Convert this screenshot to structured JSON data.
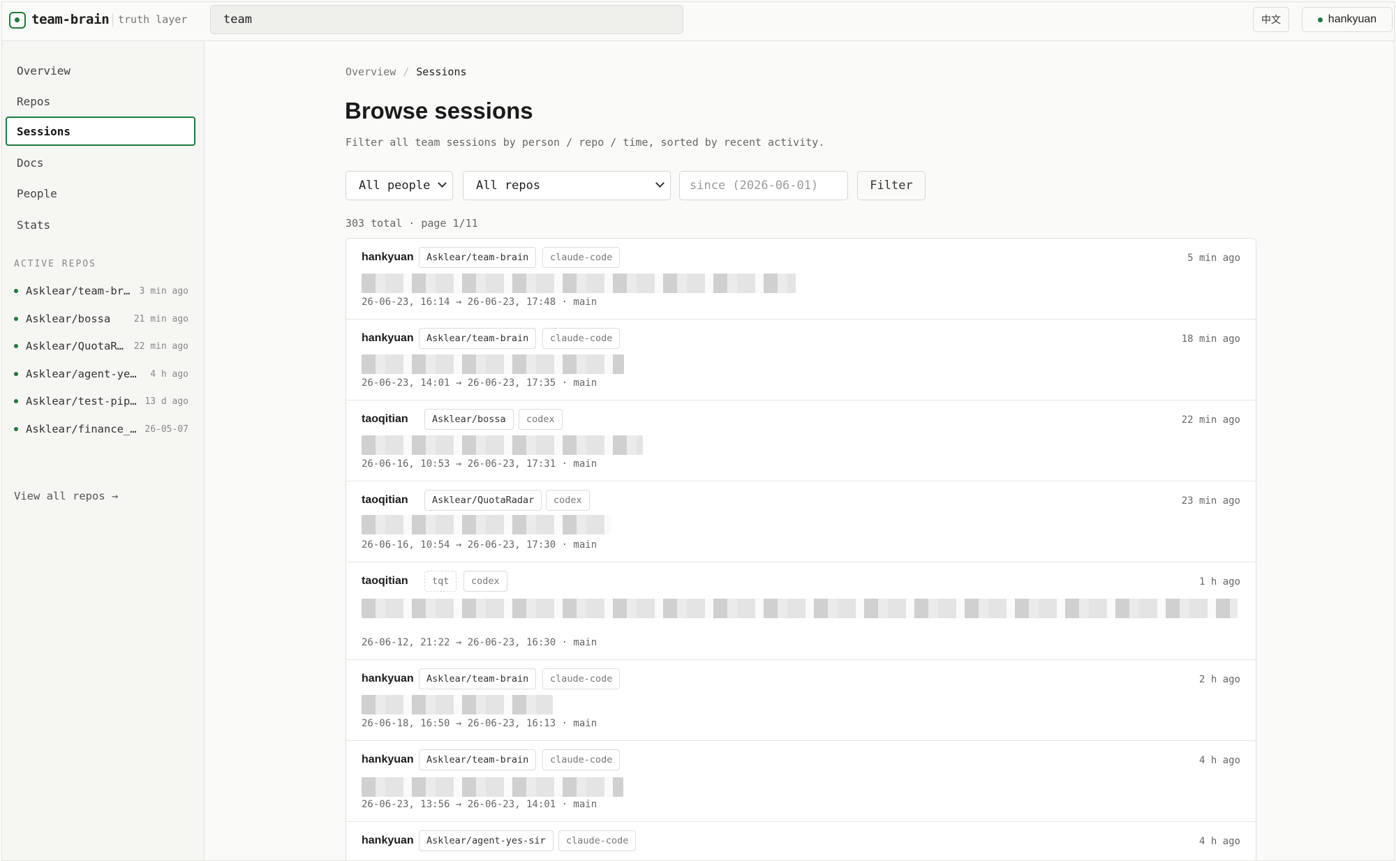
{
  "header": {
    "brand_name": "team-brain",
    "brand_tag": "truth layer",
    "search_value": "team",
    "lang_label": "中文",
    "user_label": "hankyuan"
  },
  "sidebar": {
    "items": [
      {
        "label": "Overview"
      },
      {
        "label": "Repos"
      },
      {
        "label": "Sessions",
        "active": true
      },
      {
        "label": "Docs"
      },
      {
        "label": "People"
      },
      {
        "label": "Stats"
      }
    ],
    "section_label": "ACTIVE REPOS",
    "repos": [
      {
        "name": "Asklear/team-br…",
        "time": "3 min ago"
      },
      {
        "name": "Asklear/bossa",
        "time": "21 min ago"
      },
      {
        "name": "Asklear/QuotaR…",
        "time": "22 min ago"
      },
      {
        "name": "Asklear/agent-ye…",
        "time": "4 h ago"
      },
      {
        "name": "Asklear/test-pip…",
        "time": "13 d ago"
      },
      {
        "name": "Asklear/finance_…",
        "time": "26-05-07"
      }
    ],
    "view_all": "View all repos →"
  },
  "main": {
    "breadcrumb": {
      "root": "Overview",
      "sep": "/",
      "current": "Sessions"
    },
    "title": "Browse sessions",
    "subtitle": "Filter all team sessions by person / repo / time, sorted by recent activity.",
    "filters": {
      "people": "All people",
      "repos": "All repos",
      "since_placeholder": "since (2026-06-01)",
      "filter_label": "Filter"
    },
    "total": "303 total · page 1/11",
    "sessions": [
      {
        "who": "hankyuan",
        "repo": "Asklear/team-brain",
        "agent": "claude-code",
        "ago": "5 min ago",
        "range": "26-06-23, 16:14 → 26-06-23, 17:48 · main"
      },
      {
        "who": "hankyuan",
        "repo": "Asklear/team-brain",
        "agent": "claude-code",
        "ago": "18 min ago",
        "range": "26-06-23, 14:01 → 26-06-23, 17:35 · main"
      },
      {
        "who": "taoqitian",
        "repo": "Asklear/bossa",
        "agent": "codex",
        "ago": "22 min ago",
        "range": "26-06-16, 10:53 → 26-06-23, 17:31 · main"
      },
      {
        "who": "taoqitian",
        "repo": "Asklear/QuotaRadar",
        "agent": "codex",
        "ago": "23 min ago",
        "range": "26-06-16, 10:54 → 26-06-23, 17:30 · main"
      },
      {
        "who": "taoqitian",
        "repo": "tqt",
        "agent": "codex",
        "ago": "1 h ago",
        "range": "26-06-12, 21:22 → 26-06-23, 16:30 · main"
      },
      {
        "who": "hankyuan",
        "repo": "Asklear/team-brain",
        "agent": "claude-code",
        "ago": "2 h ago",
        "range": "26-06-18, 16:50 → 26-06-23, 16:13 · main"
      },
      {
        "who": "hankyuan",
        "repo": "Asklear/team-brain",
        "agent": "claude-code",
        "ago": "4 h ago",
        "range": "26-06-23, 13:56 → 26-06-23, 14:01 · main"
      },
      {
        "who": "hankyuan",
        "repo": "Asklear/agent-yes-sir",
        "agent": "claude-code",
        "ago": "4 h ago",
        "range": ""
      }
    ]
  }
}
